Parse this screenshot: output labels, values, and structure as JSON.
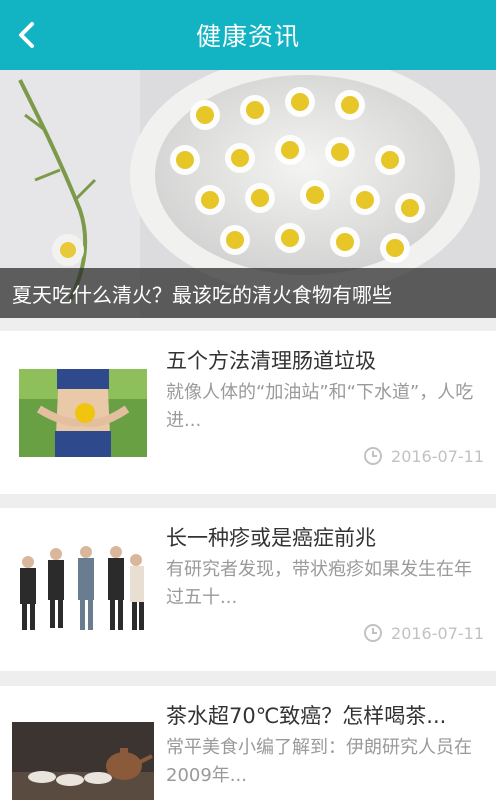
{
  "header": {
    "title": "健康资讯",
    "back_icon": "chevron-left-icon"
  },
  "banner": {
    "caption": "夏天吃什么清火？最该吃的清火食物有哪些"
  },
  "articles": [
    {
      "title": "五个方法清理肠道垃圾",
      "summary": "就像人体的“加油站”和“下水道”，人吃进...",
      "date": "2016-07-11"
    },
    {
      "title": "长一种疹或是癌症前兆",
      "summary": "有研究者发现，带状疱疹如果发生在年过五十...",
      "date": "2016-07-11"
    },
    {
      "title": "茶水超70℃致癌？怎样喝茶...",
      "summary": "常平美食小编了解到：伊朗研究人员在2009年...",
      "date": ""
    }
  ],
  "colors": {
    "header_bg": "#12b3c3",
    "separator": "#eeeeee",
    "date_text": "#c2c2c2"
  }
}
